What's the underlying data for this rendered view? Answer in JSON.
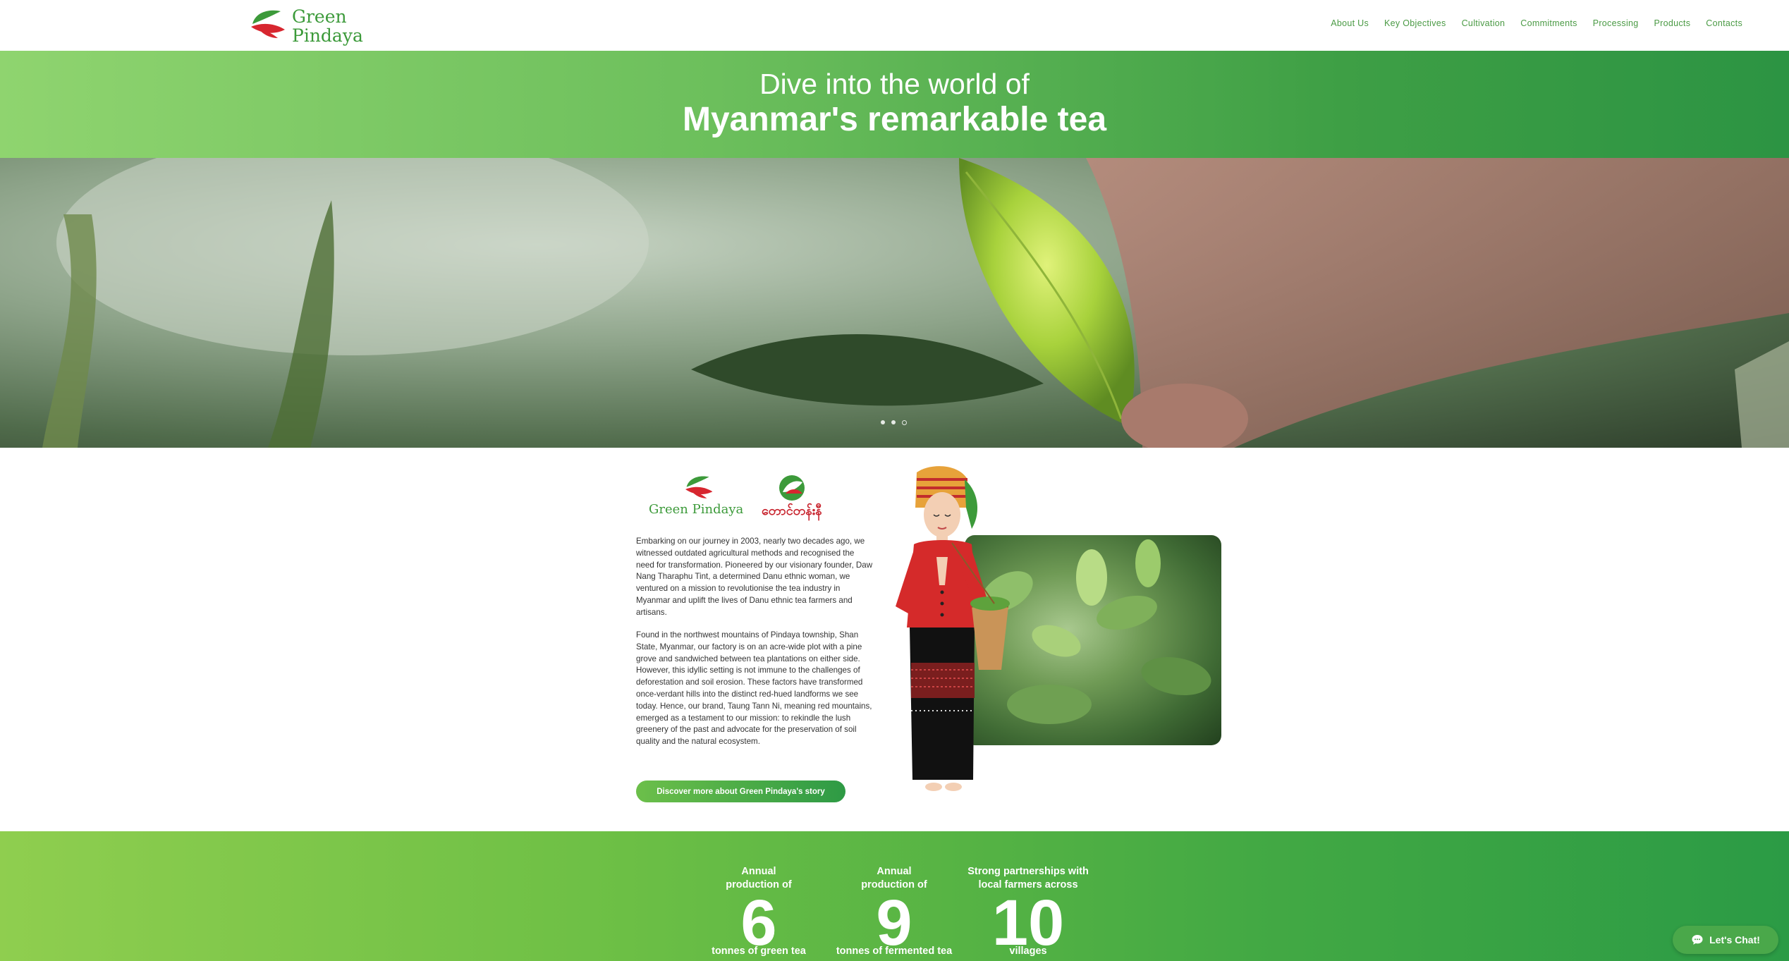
{
  "brand": {
    "name_line1": "Green",
    "name_line2": "Pindaya",
    "intro_logo_text": "Green Pindaya",
    "second_logo_text": "တောင်တန်းနီ"
  },
  "nav": [
    "About Us",
    "Key Objectives",
    "Cultivation",
    "Commitments",
    "Processing",
    "Products",
    "Contacts"
  ],
  "hero": {
    "line1": "Dive into the world of",
    "line2": "Myanmar's remarkable tea",
    "slides": 3,
    "active_slide": 3
  },
  "intro": {
    "paragraph1": "Embarking on our journey in 2003, nearly two decades ago, we witnessed outdated agricultural methods and recognised the need for transformation. Pioneered by our visionary founder, Daw Nang Tharaphu Tint, a determined Danu ethnic woman, we ventured on a mission to revolutionise the tea industry in Myanmar and uplift the lives of Danu ethnic tea farmers and artisans.",
    "paragraph2": "Found in the northwest mountains of Pindaya township, Shan State, Myanmar, our factory is on an acre-wide plot with a pine grove and sandwiched between tea plantations on either side. However, this idyllic setting is not immune to the challenges of deforestation and soil erosion. These factors have transformed once-verdant hills into the distinct red-hued landforms we see today. Hence, our brand, Taung Tann Ni, meaning red mountains, emerged as a testament to our mission: to rekindle the lush greenery of the past and advocate for the preservation of soil quality and the natural ecosystem.",
    "button": "Discover more about Green Pindaya's story"
  },
  "stats": [
    {
      "label_line1": "Annual",
      "label_line2": "production of",
      "number": "6",
      "unit": "tonnes of green tea"
    },
    {
      "label_line1": "Annual",
      "label_line2": "production of",
      "number": "9",
      "unit": "tonnes of fermented tea"
    },
    {
      "label_line1": "Strong partnerships with",
      "label_line2": "local farmers across",
      "number": "10",
      "unit": "villages"
    }
  ],
  "chat": {
    "label": "Let's Chat!"
  },
  "colors": {
    "brand_green": "#3c9a3a",
    "brand_red": "#c8242e",
    "nav_green": "#4a9a44"
  }
}
